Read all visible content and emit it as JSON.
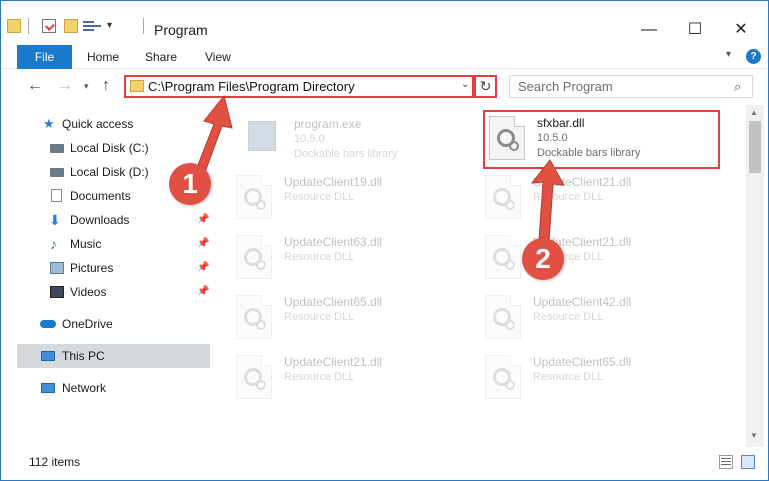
{
  "window": {
    "title": "Program",
    "minimize_glyph": "—",
    "maximize_glyph": "☐",
    "close_glyph": "✕"
  },
  "ribbon": {
    "tabs": [
      {
        "label": "File"
      },
      {
        "label": "Home"
      },
      {
        "label": "Share"
      },
      {
        "label": "View"
      }
    ],
    "help_glyph": "?"
  },
  "navbar": {
    "address": "C:\\Program Files\\Program Directory",
    "search_placeholder": "Search Program",
    "back_glyph": "←",
    "forward_glyph": "→",
    "up_glyph": "↑",
    "refresh_glyph": "↻",
    "search_glyph": "⌕"
  },
  "sidebar": {
    "items": [
      {
        "label": "Quick access",
        "icon": "star-icon"
      },
      {
        "label": "Local Disk (C:)",
        "icon": "disk-icon"
      },
      {
        "label": "Local Disk (D:)",
        "icon": "disk-icon"
      },
      {
        "label": "Documents",
        "icon": "document-icon"
      },
      {
        "label": "Downloads",
        "icon": "download-icon",
        "pinned": true
      },
      {
        "label": "Music",
        "icon": "music-icon",
        "pinned": true
      },
      {
        "label": "Pictures",
        "icon": "pictures-icon",
        "pinned": true
      },
      {
        "label": "Videos",
        "icon": "videos-icon",
        "pinned": true
      },
      {
        "label": "OneDrive",
        "icon": "cloud-icon"
      },
      {
        "label": "This PC",
        "icon": "computer-icon",
        "selected": true
      },
      {
        "label": "Network",
        "icon": "network-icon"
      }
    ],
    "pin_glyph": "📌"
  },
  "files": {
    "highlighted": {
      "name": "sfxbar.dll",
      "version": "10.5.0",
      "description": "Dockable bars library"
    },
    "program": {
      "name": "program.exe",
      "version": "10.5.0",
      "description": "Dockable bars library"
    },
    "left_column": [
      {
        "name": "UpdateClient19.dll",
        "description": "Resource DLL"
      },
      {
        "name": "UpdateClient63.dll",
        "description": "Resource DLL"
      },
      {
        "name": "UpdateClient65.dll",
        "description": "Resource DLL"
      },
      {
        "name": "UpdateClient21.dll",
        "description": "Resource DLL"
      }
    ],
    "right_column": [
      {
        "name": "UpdateClient21.dll",
        "description": "Resource DLL"
      },
      {
        "name": "UpdateClient21.dll",
        "description": "Resource DLL"
      },
      {
        "name": "UpdateClient42.dll",
        "description": "Resource DLL"
      },
      {
        "name": "UpdateClient65.dll",
        "description": "Resource DLL"
      }
    ]
  },
  "status": {
    "item_count": "112 items"
  },
  "annotations": {
    "step1": "1",
    "step2": "2",
    "color": "#e24f43"
  },
  "colors": {
    "accent": "#1979ca",
    "highlight_border": "#e33e3e"
  }
}
